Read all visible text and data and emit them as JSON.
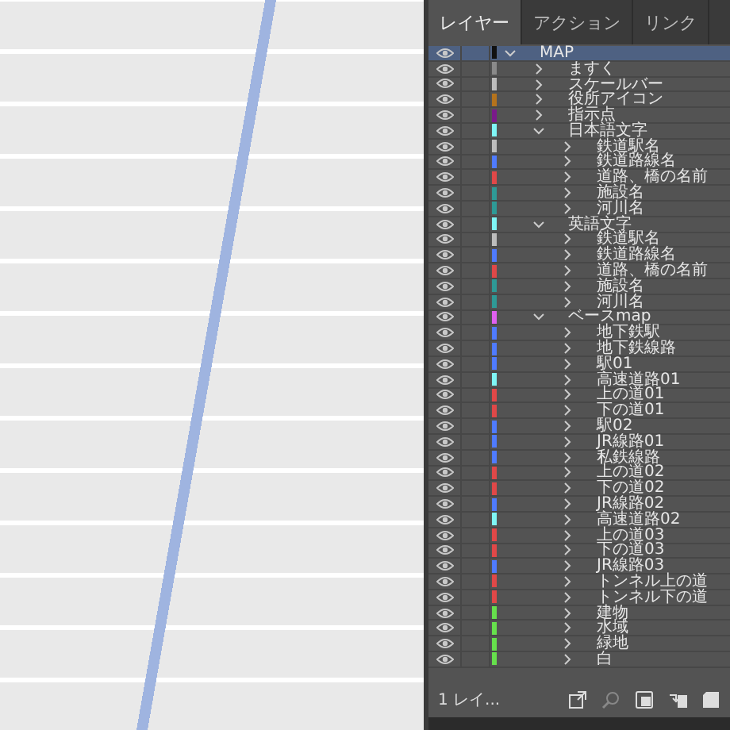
{
  "map": {
    "kind": "street-map"
  },
  "tabs": [
    {
      "label": "レイヤー",
      "selected": true
    },
    {
      "label": "アクション",
      "selected": false
    },
    {
      "label": "リンク",
      "selected": false
    }
  ],
  "layers": [
    {
      "name": "MAP",
      "color": "#111111",
      "visible": true,
      "expanded": true,
      "selected": true,
      "children": [
        {
          "name": "ますく",
          "color": "#8a8a8a",
          "visible": true,
          "expanded": false,
          "selected": false
        },
        {
          "name": "スケールバー",
          "color": "#bdbdbd",
          "visible": true,
          "expanded": false,
          "selected": false
        },
        {
          "name": "役所アイコン",
          "color": "#b5731c",
          "visible": true,
          "expanded": false,
          "selected": false
        },
        {
          "name": "指示点",
          "color": "#7a1a8a",
          "visible": true,
          "expanded": false,
          "selected": false
        },
        {
          "name": "日本語文字",
          "color": "#7ff6f6",
          "visible": true,
          "expanded": true,
          "selected": false,
          "children": [
            {
              "name": "鉄道駅名",
              "color": "#bdbdbd",
              "visible": true,
              "expanded": false,
              "selected": false
            },
            {
              "name": "鉄道路線名",
              "color": "#4f7bff",
              "visible": true,
              "expanded": false,
              "selected": false
            },
            {
              "name": "道路、橋の名前",
              "color": "#e04848",
              "visible": true,
              "expanded": false,
              "selected": false
            },
            {
              "name": "施設名",
              "color": "#2e9a96",
              "visible": true,
              "expanded": false,
              "selected": false
            },
            {
              "name": "河川名",
              "color": "#2e9a96",
              "visible": true,
              "expanded": false,
              "selected": false
            }
          ]
        },
        {
          "name": "英語文字",
          "color": "#7ff6f6",
          "visible": true,
          "expanded": true,
          "selected": false,
          "children": [
            {
              "name": "鉄道駅名",
              "color": "#bdbdbd",
              "visible": true,
              "expanded": false,
              "selected": false
            },
            {
              "name": "鉄道路線名",
              "color": "#4f7bff",
              "visible": true,
              "expanded": false,
              "selected": false
            },
            {
              "name": "道路、橋の名前",
              "color": "#e04848",
              "visible": true,
              "expanded": false,
              "selected": false
            },
            {
              "name": "施設名",
              "color": "#2e9a96",
              "visible": true,
              "expanded": false,
              "selected": false
            },
            {
              "name": "河川名",
              "color": "#2e9a96",
              "visible": true,
              "expanded": false,
              "selected": false
            }
          ]
        },
        {
          "name": "ベースmap",
          "color": "#e060f0",
          "visible": true,
          "expanded": true,
          "selected": false,
          "children": [
            {
              "name": "地下鉄駅",
              "color": "#4f7bff",
              "visible": true,
              "expanded": false,
              "selected": false
            },
            {
              "name": "地下鉄線路",
              "color": "#4f7bff",
              "visible": true,
              "expanded": false,
              "selected": false
            },
            {
              "name": "駅01",
              "color": "#4f7bff",
              "visible": true,
              "expanded": false,
              "selected": false
            },
            {
              "name": "高速道路01",
              "color": "#7ff6f6",
              "visible": true,
              "expanded": false,
              "selected": false
            },
            {
              "name": "上の道01",
              "color": "#e04848",
              "visible": true,
              "expanded": false,
              "selected": false
            },
            {
              "name": "下の道01",
              "color": "#e04848",
              "visible": true,
              "expanded": false,
              "selected": false
            },
            {
              "name": "駅02",
              "color": "#4f7bff",
              "visible": true,
              "expanded": false,
              "selected": false
            },
            {
              "name": "JR線路01",
              "color": "#4f7bff",
              "visible": true,
              "expanded": false,
              "selected": false
            },
            {
              "name": "私鉄線路",
              "color": "#4f7bff",
              "visible": true,
              "expanded": false,
              "selected": false
            },
            {
              "name": "上の道02",
              "color": "#e04848",
              "visible": true,
              "expanded": false,
              "selected": false
            },
            {
              "name": "下の道02",
              "color": "#e04848",
              "visible": true,
              "expanded": false,
              "selected": false
            },
            {
              "name": "JR線路02",
              "color": "#4f7bff",
              "visible": true,
              "expanded": false,
              "selected": false
            },
            {
              "name": "高速道路02",
              "color": "#7ff6f6",
              "visible": true,
              "expanded": false,
              "selected": false
            },
            {
              "name": "上の道03",
              "color": "#e04848",
              "visible": true,
              "expanded": false,
              "selected": false
            },
            {
              "name": "下の道03",
              "color": "#e04848",
              "visible": true,
              "expanded": false,
              "selected": false
            },
            {
              "name": "JR線路03",
              "color": "#4f7bff",
              "visible": true,
              "expanded": false,
              "selected": false
            },
            {
              "name": "トンネル上の道",
              "color": "#e04848",
              "visible": true,
              "expanded": false,
              "selected": false
            },
            {
              "name": "トンネル下の道",
              "color": "#e04848",
              "visible": true,
              "expanded": false,
              "selected": false
            },
            {
              "name": "建物",
              "color": "#66e04c",
              "visible": true,
              "expanded": false,
              "selected": false
            },
            {
              "name": "水域",
              "color": "#66e04c",
              "visible": true,
              "expanded": false,
              "selected": false
            },
            {
              "name": "緑地",
              "color": "#66e04c",
              "visible": true,
              "expanded": false,
              "selected": false
            },
            {
              "name": "白",
              "color": "#66e04c",
              "visible": true,
              "expanded": false,
              "selected": false
            }
          ]
        }
      ]
    }
  ],
  "footer": {
    "layer_count": "1 レイ..."
  }
}
